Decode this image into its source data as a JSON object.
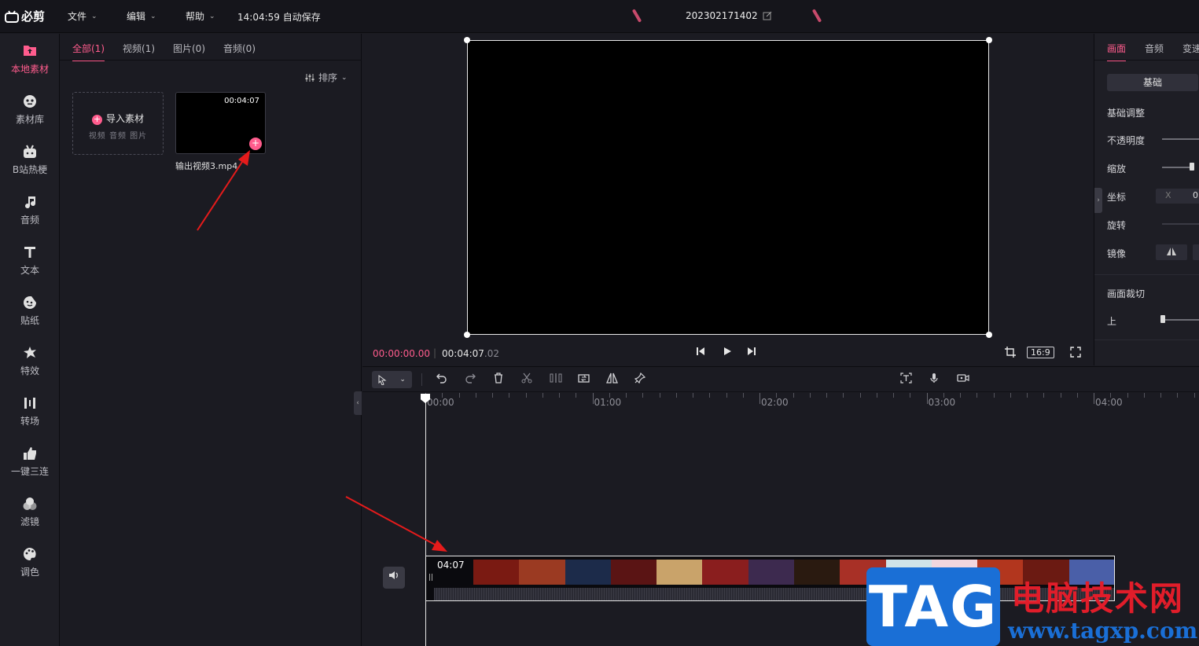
{
  "app": {
    "name": "必剪"
  },
  "menubar": {
    "items": [
      {
        "label": "文件"
      },
      {
        "label": "编辑"
      },
      {
        "label": "帮助"
      }
    ],
    "autosave": "14:04:59 自动保存",
    "project_name": "202302171402"
  },
  "rail": {
    "items": [
      {
        "label": "本地素材",
        "icon": "folder-upload-icon"
      },
      {
        "label": "素材库",
        "icon": "face-icon"
      },
      {
        "label": "B站热梗",
        "icon": "bilibili-tv-icon"
      },
      {
        "label": "音频",
        "icon": "music-note-icon"
      },
      {
        "label": "文本",
        "icon": "text-t-icon"
      },
      {
        "label": "贴纸",
        "icon": "sticker-icon"
      },
      {
        "label": "特效",
        "icon": "star-burst-icon"
      },
      {
        "label": "转场",
        "icon": "transition-icon"
      },
      {
        "label": "一键三连",
        "icon": "thumbs-up-icon"
      },
      {
        "label": "滤镜",
        "icon": "filter-circles-icon"
      },
      {
        "label": "调色",
        "icon": "palette-icon"
      }
    ]
  },
  "media": {
    "tabs": [
      {
        "label": "全部(1)"
      },
      {
        "label": "视频(1)"
      },
      {
        "label": "图片(0)"
      },
      {
        "label": "音频(0)"
      }
    ],
    "sort_label": "排序",
    "import_label": "导入素材",
    "import_hint": "视频 音频 图片",
    "clip": {
      "duration": "00:04:07",
      "name": "输出视频3.mp4"
    }
  },
  "preview": {
    "current_time": "00:00:00.00",
    "total_time": "00:04:07",
    "total_ms": ".02",
    "aspect_ratio": "16:9"
  },
  "properties": {
    "tabs": [
      {
        "label": "画面"
      },
      {
        "label": "音频"
      },
      {
        "label": "变速"
      }
    ],
    "basic_button": "基础",
    "section_title": "基础调整",
    "opacity_label": "不透明度",
    "scale_label": "缩放",
    "position_label": "坐标",
    "position_x_label": "X",
    "position_x_value": "0",
    "rotate_label": "旋转",
    "mirror_label": "镜像",
    "crop_title": "画面裁切",
    "crop_top_label": "上"
  },
  "timeline": {
    "ruler_labels": [
      "00:00",
      "01:00",
      "02:00",
      "03:00",
      "04:00"
    ],
    "clip_duration": "04:07",
    "frame_colors": [
      "#7a1a12",
      "#9b3a22",
      "#1c2b4a",
      "#5a1414",
      "#c9a36a",
      "#8a1e1e",
      "#3d2a4f",
      "#2a1a10",
      "#a83026",
      "#cfe3e8",
      "#f1d6de",
      "#b2361e",
      "#6b1a12",
      "#4a5fa8"
    ]
  },
  "watermark": {
    "tag": "TAG",
    "site_name": "电脑技术网",
    "url": "www.tagxp.com"
  }
}
